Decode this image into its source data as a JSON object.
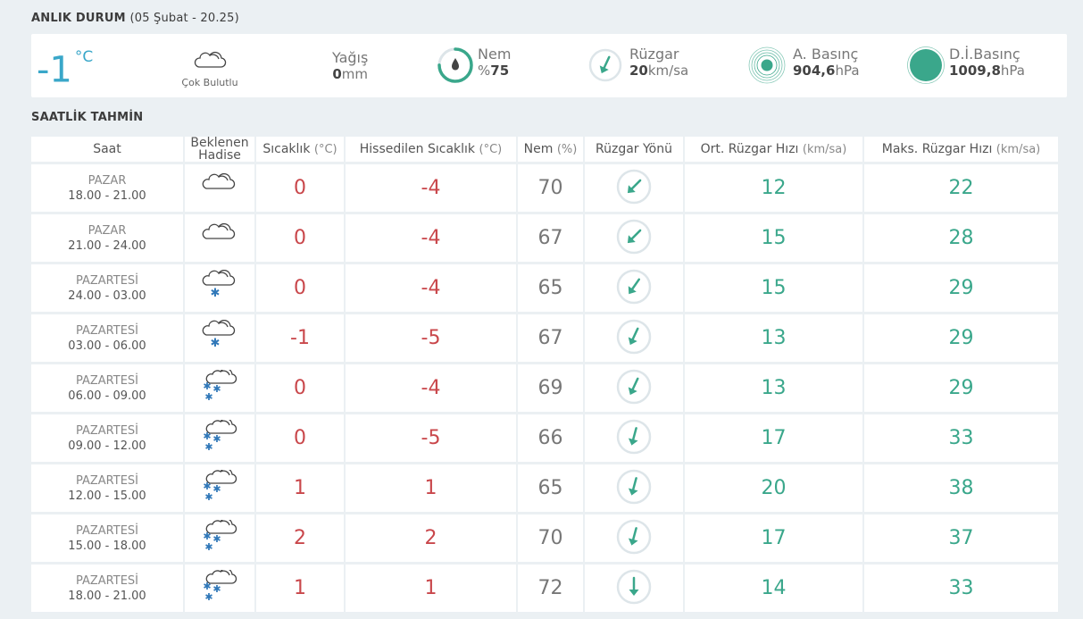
{
  "current": {
    "heading": "ANLIK DURUM",
    "date_text": "05 Şubat - 20.25",
    "temperature": "-1",
    "temp_unit": "°C",
    "condition_icon": "cloud-icon",
    "condition": "Çok Bulutlu",
    "rain_label": "Yağış",
    "rain_value": "0",
    "rain_unit": "mm",
    "humidity_label": "Nem",
    "humidity_prefix": "%",
    "humidity_value": "75",
    "humidity_fraction": 0.75,
    "wind_label": "Rüzgar",
    "wind_value": "20",
    "wind_unit": "km/sa",
    "pressure_label": "A. Basınç",
    "pressure_value": "904,6",
    "pressure_unit": "hPa",
    "sea_pressure_label": "D.İ.Basınç",
    "sea_pressure_value": "1009,8",
    "sea_pressure_unit": "hPa",
    "accent_color": "#3aa78b",
    "temp_color": "#3aa7c9"
  },
  "hourly": {
    "heading": "SAATLİK TAHMİN",
    "headers": {
      "saat": "Saat",
      "hadise_1": "Beklenen",
      "hadise_2": "Hadise",
      "sicaklik": "Sıcaklık",
      "sicaklik_u": "(°C)",
      "hissedilen": "Hissedilen Sıcaklık",
      "hissedilen_u": "(°C)",
      "nem": "Nem",
      "nem_u": "(%)",
      "yon": "Rüzgar Yönü",
      "ort": "Ort. Rüzgar Hızı",
      "ort_u": "(km/sa)",
      "maks": "Maks. Rüzgar Hızı",
      "maks_u": "(km/sa)"
    },
    "rows": [
      {
        "day": "PAZAR",
        "hours": "18.00 - 21.00",
        "icon": "cloud-icon",
        "temp": "0",
        "feels": "-4",
        "hum": "70",
        "dir": 45,
        "avg": "12",
        "max": "22"
      },
      {
        "day": "PAZAR",
        "hours": "21.00 - 24.00",
        "icon": "cloud-icon",
        "temp": "0",
        "feels": "-4",
        "hum": "67",
        "dir": 45,
        "avg": "15",
        "max": "28"
      },
      {
        "day": "PAZARTESİ",
        "hours": "24.00 - 03.00",
        "icon": "cloud-snow-icon",
        "temp": "0",
        "feels": "-4",
        "hum": "65",
        "dir": 35,
        "avg": "15",
        "max": "29"
      },
      {
        "day": "PAZARTESİ",
        "hours": "03.00 - 06.00",
        "icon": "cloud-snow-icon",
        "temp": "-1",
        "feels": "-5",
        "hum": "67",
        "dir": 25,
        "avg": "13",
        "max": "29"
      },
      {
        "day": "PAZARTESİ",
        "hours": "06.00 - 09.00",
        "icon": "cloud-heavy-snow-icon",
        "temp": "0",
        "feels": "-4",
        "hum": "69",
        "dir": 25,
        "avg": "13",
        "max": "29"
      },
      {
        "day": "PAZARTESİ",
        "hours": "09.00 - 12.00",
        "icon": "cloud-heavy-snow-icon",
        "temp": "0",
        "feels": "-5",
        "hum": "66",
        "dir": 15,
        "avg": "17",
        "max": "33"
      },
      {
        "day": "PAZARTESİ",
        "hours": "12.00 - 15.00",
        "icon": "cloud-heavy-snow-icon",
        "temp": "1",
        "feels": "1",
        "hum": "65",
        "dir": 15,
        "avg": "20",
        "max": "38"
      },
      {
        "day": "PAZARTESİ",
        "hours": "15.00 - 18.00",
        "icon": "cloud-heavy-snow-icon",
        "temp": "2",
        "feels": "2",
        "hum": "70",
        "dir": 15,
        "avg": "17",
        "max": "37"
      },
      {
        "day": "PAZARTESİ",
        "hours": "18.00 - 21.00",
        "icon": "cloud-heavy-snow-icon",
        "temp": "1",
        "feels": "1",
        "hum": "72",
        "dir": 0,
        "avg": "14",
        "max": "33"
      }
    ],
    "colors": {
      "temp": "#c9474b",
      "humidity": "#777777",
      "wind": "#3aa78b"
    }
  }
}
